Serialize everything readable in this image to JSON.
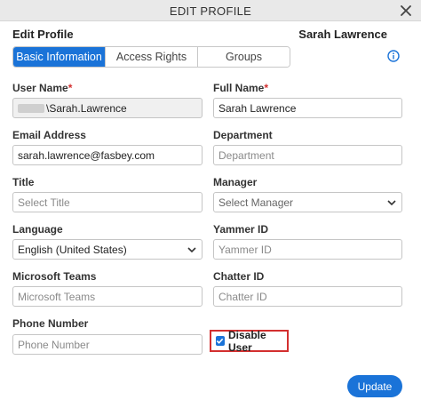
{
  "window": {
    "title": "EDIT PROFILE"
  },
  "header": {
    "heading": "Edit Profile",
    "user_display_name": "Sarah Lawrence"
  },
  "tabs": [
    {
      "label": "Basic Information",
      "active": true
    },
    {
      "label": "Access Rights",
      "active": false
    },
    {
      "label": "Groups",
      "active": false
    }
  ],
  "form": {
    "user_name": {
      "label": "User Name",
      "required_mark": "*",
      "value": "\\Sarah.Lawrence"
    },
    "full_name": {
      "label": "Full Name",
      "required_mark": "*",
      "value": "Sarah Lawrence"
    },
    "email": {
      "label": "Email Address",
      "value": "sarah.lawrence@fasbey.com"
    },
    "department": {
      "label": "Department",
      "placeholder": "Department"
    },
    "title": {
      "label": "Title",
      "placeholder": "Select Title"
    },
    "manager": {
      "label": "Manager",
      "placeholder": "Select Manager"
    },
    "language": {
      "label": "Language",
      "value": "English (United States)"
    },
    "yammer": {
      "label": "Yammer ID",
      "placeholder": "Yammer ID"
    },
    "teams": {
      "label": "Microsoft Teams",
      "placeholder": "Microsoft Teams"
    },
    "chatter": {
      "label": "Chatter ID",
      "placeholder": "Chatter ID"
    },
    "phone": {
      "label": "Phone Number",
      "placeholder": "Phone Number"
    },
    "disable_user": {
      "label": "Disable User",
      "checked": true
    }
  },
  "actions": {
    "update_label": "Update"
  },
  "colors": {
    "accent": "#1a73d8",
    "highlight": "#d32f2f",
    "required": "#d32f2f"
  }
}
